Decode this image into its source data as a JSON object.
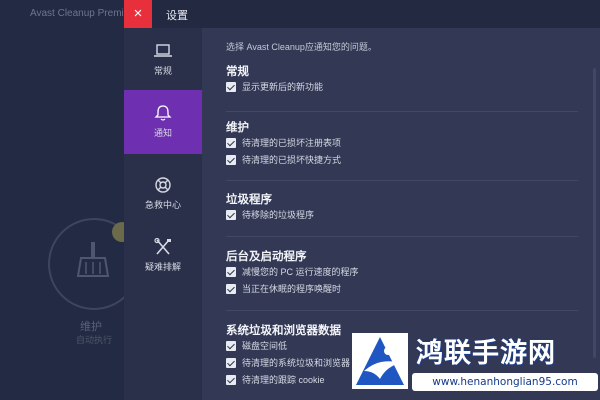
{
  "background_app": {
    "title": "Avast Cleanup Premium",
    "ring_label": "维护",
    "ring_sublabel": "自动执行"
  },
  "dialog": {
    "close_icon": "×",
    "title": "设置"
  },
  "sidebar": {
    "items": [
      {
        "label": "常规",
        "icon": "laptop-icon",
        "active": false
      },
      {
        "label": "通知",
        "icon": "bell-icon",
        "active": true
      },
      {
        "label": "急救中心",
        "icon": "lifebuoy-icon",
        "active": false
      },
      {
        "label": "疑难排解",
        "icon": "tools-icon",
        "active": false
      }
    ]
  },
  "content": {
    "intro": "选择 Avast Cleanup应通知您的问题。",
    "sections": [
      {
        "title": "常规",
        "options": [
          "显示更新后的新功能"
        ]
      },
      {
        "title": "维护",
        "options": [
          "待清理的已损坏注册表项",
          "待清理的已损坏快捷方式"
        ]
      },
      {
        "title": "垃圾程序",
        "options": [
          "待移除的垃圾程序"
        ]
      },
      {
        "title": "后台及启动程序",
        "options": [
          "减慢您的 PC 运行速度的程序",
          "当正在休眠的程序唤醒时"
        ]
      },
      {
        "title": "系统垃圾和浏览器数据",
        "options": [
          "磁盘空间低",
          "待清理的系统垃圾和浏览器",
          "待清理的跟踪 cookie"
        ]
      }
    ]
  },
  "watermark": {
    "title": "鸿联手游网",
    "url": "www.henanhonglian95.com"
  },
  "colors": {
    "accent_active": "#6e2fb0",
    "close_red": "#e8303d",
    "content_bg": "#333955"
  }
}
